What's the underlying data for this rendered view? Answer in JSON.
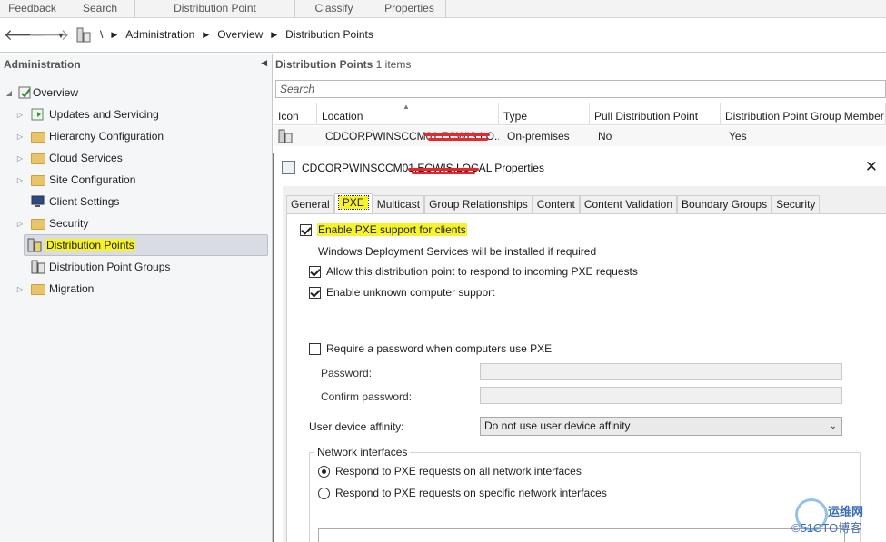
{
  "ribbon": {
    "tabs": [
      "Feedback",
      "Search",
      "Distribution Point",
      "Classify",
      "Properties"
    ]
  },
  "address": {
    "back_icon": "back-arrow-icon",
    "forward_icon": "forward-arrow-icon",
    "root": "\\",
    "crumbs": [
      "Administration",
      "Overview",
      "Distribution Points"
    ]
  },
  "left": {
    "title": "Administration",
    "tree": [
      {
        "label": "Overview",
        "icon": "overview-icon"
      },
      {
        "label": "Updates and Servicing",
        "icon": "updates-icon"
      },
      {
        "label": "Hierarchy Configuration",
        "icon": "folder-icon"
      },
      {
        "label": "Cloud Services",
        "icon": "folder-icon"
      },
      {
        "label": "Site Configuration",
        "icon": "folder-icon"
      },
      {
        "label": "Client Settings",
        "icon": "client-settings-icon"
      },
      {
        "label": "Security",
        "icon": "folder-icon"
      },
      {
        "label": "Distribution Points",
        "icon": "distribution-point-icon"
      },
      {
        "label": "Distribution Point Groups",
        "icon": "distribution-point-group-icon"
      },
      {
        "label": "Migration",
        "icon": "folder-icon"
      }
    ]
  },
  "right": {
    "title": "Distribution Points",
    "count": "1 items",
    "search_placeholder": "Search",
    "columns": [
      "Icon",
      "Location",
      "Type",
      "Pull Distribution Point",
      "Distribution Point Group Member"
    ],
    "rows": [
      {
        "location": "CDCORPWINSCCM01.ECWIS.LO...",
        "type": "On-premises",
        "pull": "No",
        "group_member": "Yes"
      }
    ]
  },
  "dialog": {
    "title": "CDCORPWINSCCM01.ECWIS.LOCAL Properties",
    "tabs": [
      "General",
      "PXE",
      "Multicast",
      "Group Relationships",
      "Content",
      "Content Validation",
      "Boundary Groups",
      "Security"
    ],
    "active_tab": "PXE",
    "enable_pxe": "Enable PXE support for clients",
    "wds_note": "Windows Deployment Services will be installed if required",
    "allow_pxe": "Allow this distribution point to respond to incoming PXE requests",
    "unknown_support": "Enable unknown computer support",
    "require_password": "Require a password when computers use PXE",
    "password_label": "Password:",
    "confirm_label": "Confirm password:",
    "affinity_label": "User device affinity:",
    "affinity_value": "Do not use user device affinity",
    "network_group": "Network interfaces",
    "radio_all": "Respond to PXE requests on all network interfaces",
    "radio_specific": "Respond to PXE requests on specific network interfaces"
  },
  "watermark": {
    "line1": "运维网",
    "line2": "©51CTO博客"
  }
}
